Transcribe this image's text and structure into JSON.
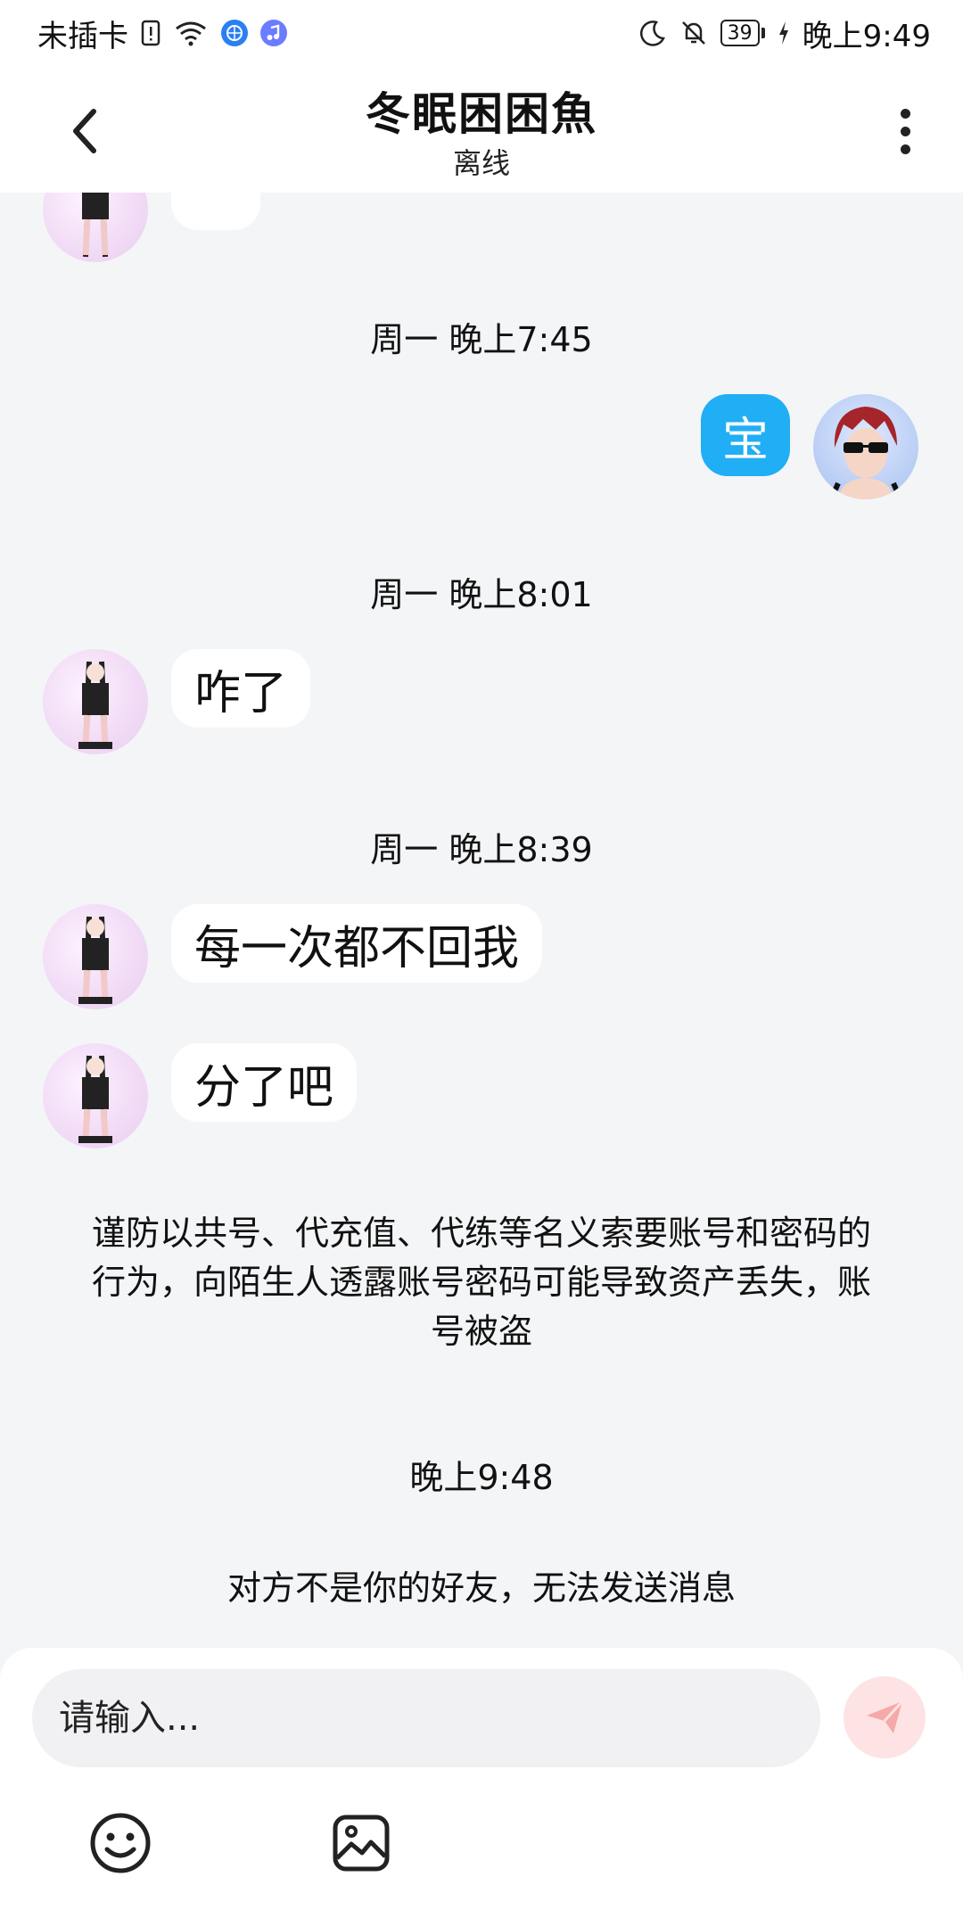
{
  "status_bar": {
    "carrier": "未插卡",
    "battery": "39",
    "time": "晚上9:49",
    "icons": [
      "sim-alert-icon",
      "wifi-icon",
      "browser-icon",
      "music-icon",
      "moon-icon",
      "mute-bell-icon",
      "battery-icon",
      "charging-icon"
    ]
  },
  "header": {
    "title": "冬眠困困魚",
    "subtitle": "离线"
  },
  "messages": {
    "t1": "周一 晚上7:45",
    "m1": "宝",
    "t2": "周一 晚上8:01",
    "m2": "咋了",
    "t3": "周一 晚上8:39",
    "m3": "每一次都不回我",
    "m4": "分了吧",
    "notice": "谨防以共号、代充值、代练等名义索要账号和密码的行为，向陌生人透露账号密码可能导致资产丢失，账号被盗",
    "t4": "晚上9:48",
    "system": "对方不是你的好友，无法发送消息"
  },
  "input": {
    "placeholder": "请输入..."
  },
  "colors": {
    "my_bubble": "#20aef5",
    "background": "#f4f5f7",
    "send_disabled": "#fde3e3",
    "send_icon": "#f6a9a9"
  }
}
